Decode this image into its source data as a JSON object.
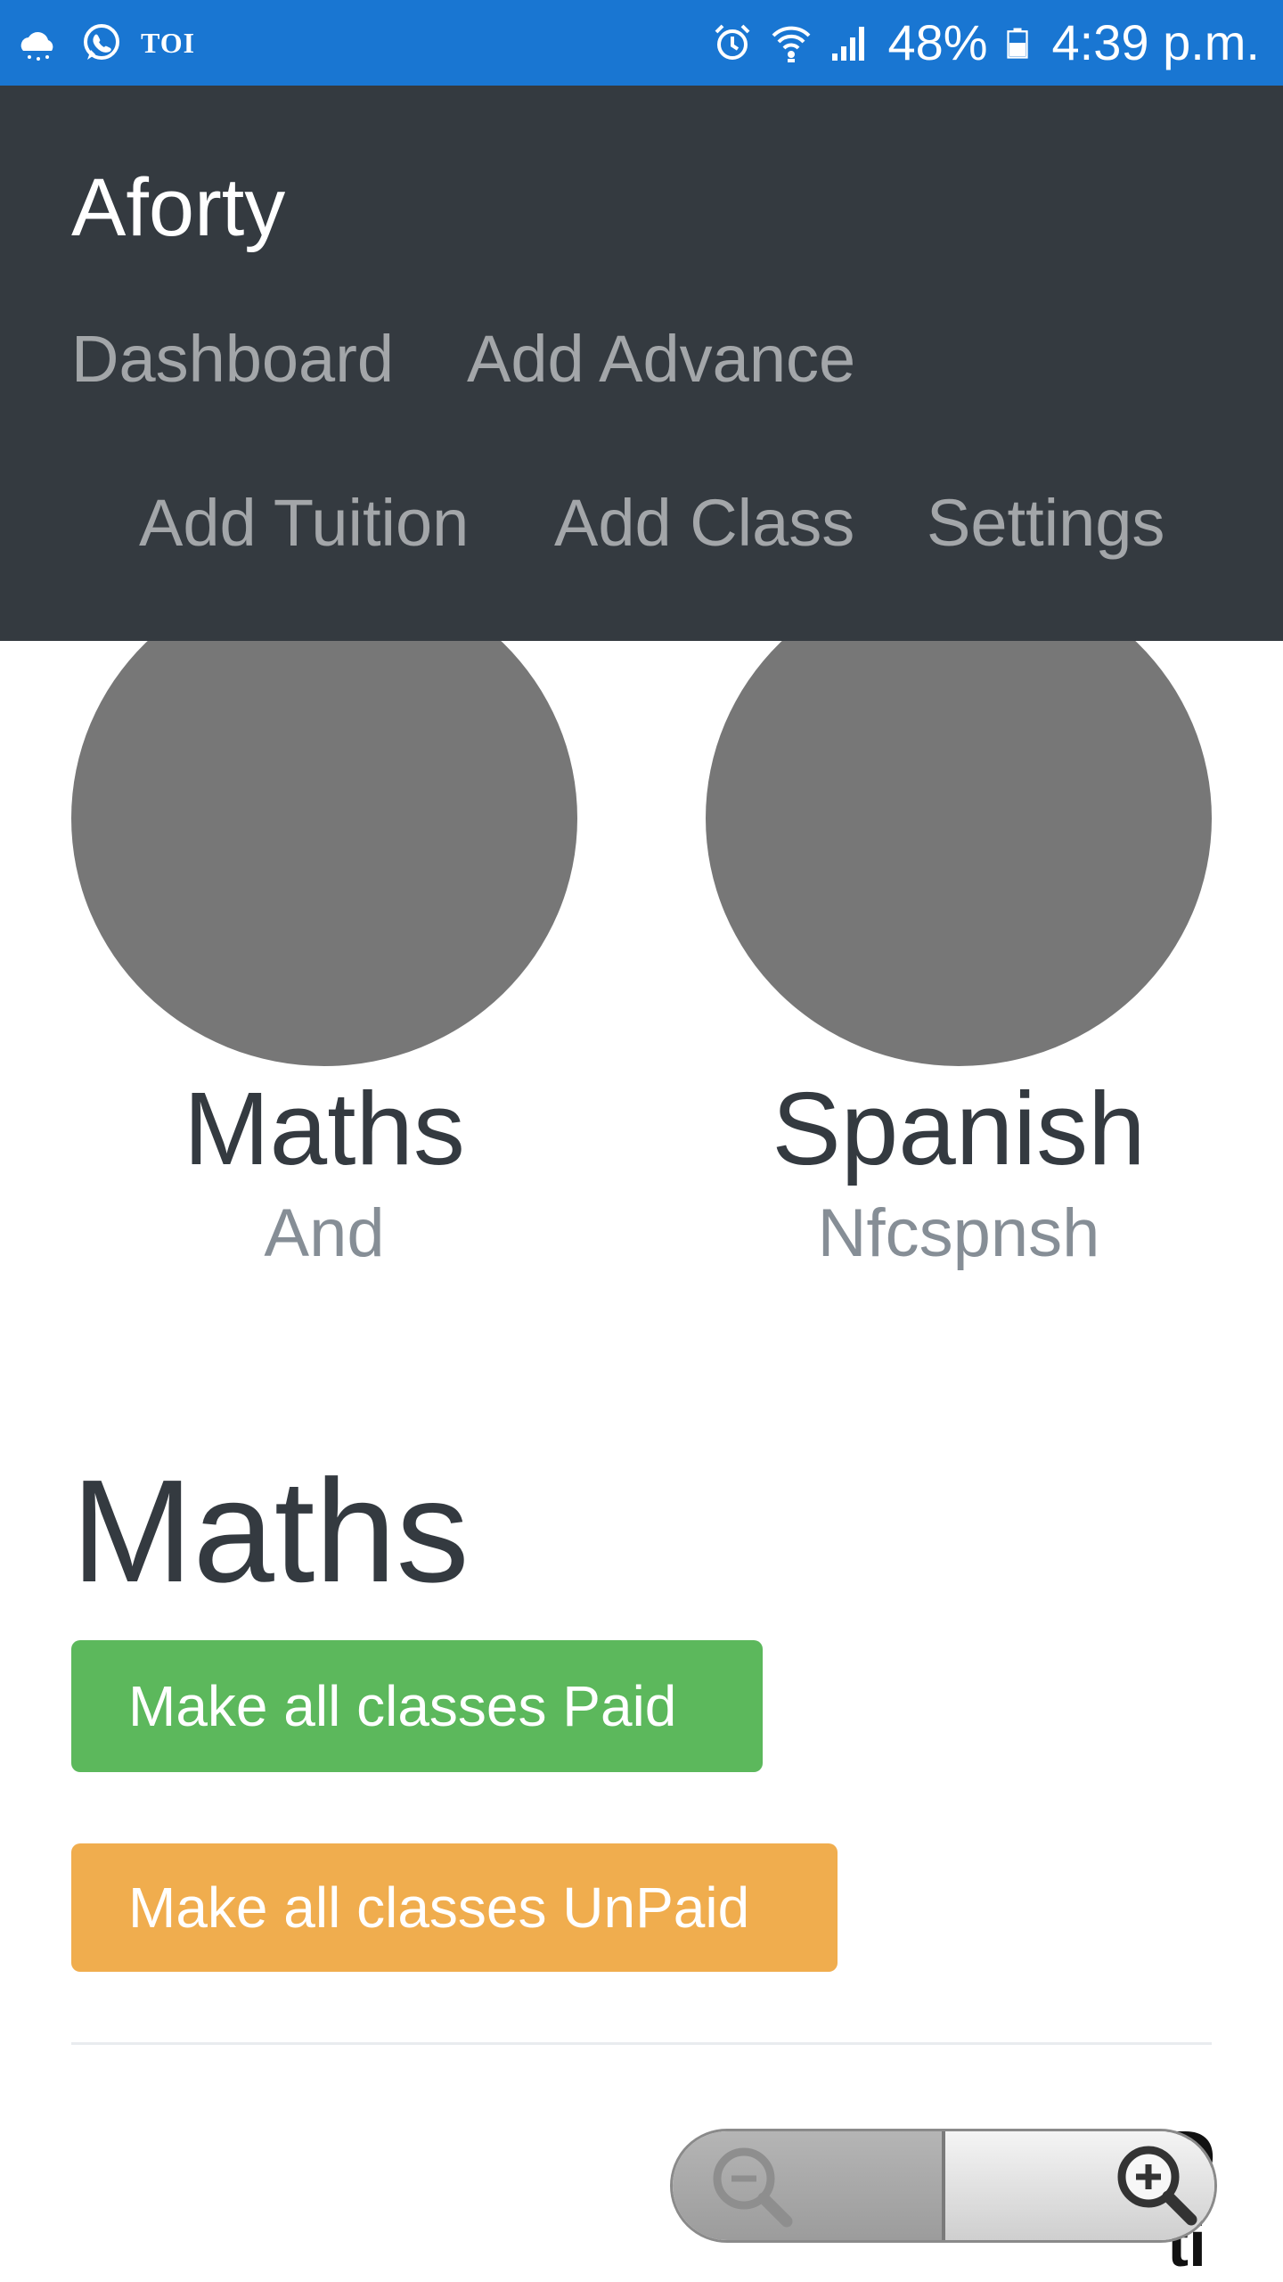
{
  "status_bar": {
    "left_label": "TOI",
    "battery": "48%",
    "time": "4:39 p.m.",
    "icons": [
      "weather-icon",
      "whatsapp-icon",
      "alarm-icon",
      "wifi-icon",
      "signal-icon",
      "battery-icon"
    ]
  },
  "navbar": {
    "brand": "Aforty",
    "links": {
      "dashboard": "Dashboard",
      "add_advance": "Add Advance",
      "add_tuition": "Add Tuition",
      "add_class": "Add Class",
      "settings": "Settings"
    }
  },
  "classes": [
    {
      "title": "Maths",
      "subtitle": "And"
    },
    {
      "title": "Spanish",
      "subtitle": "Nfcspnsh"
    }
  ],
  "section": {
    "title": "Maths",
    "paid_button": "Make all classes Paid",
    "unpaid_button": "Make all classes UnPaid",
    "cutoff_line1": "D",
    "cutoff_line2": "ti"
  },
  "zoom": {
    "out_icon": "zoom-out-icon",
    "in_icon": "zoom-in-icon"
  },
  "colors": {
    "status_bar": "#1976d2",
    "navbar": "#343a40",
    "avatar": "#777777",
    "success": "#5cb85c",
    "warning": "#f0ad4e"
  }
}
